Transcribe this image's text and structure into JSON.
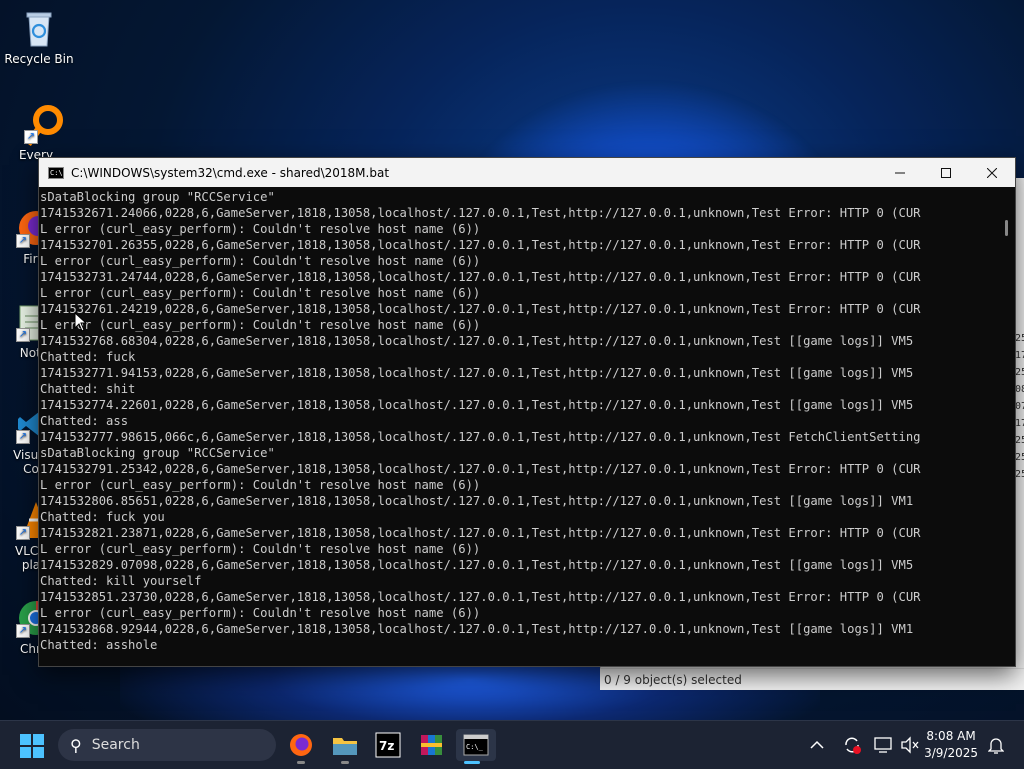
{
  "desktop": {
    "icons": [
      {
        "label": "Recycle Bin"
      },
      {
        "label": "Every"
      },
      {
        "label": "Fire"
      },
      {
        "label": "Note"
      },
      {
        "label": "Visual Co"
      },
      {
        "label": "VLC r pla"
      },
      {
        "label": "Chro"
      }
    ]
  },
  "console": {
    "title": "C:\\WINDOWS\\system32\\cmd.exe - shared\\2018M.bat",
    "lines": [
      "sDataBlocking group \"RCCService\"",
      "1741532671.24066,0228,6,GameServer,1818,13058,localhost/.127.0.0.1,Test,http://127.0.0.1,unknown,Test Error: HTTP 0 (CUR",
      "L error (curl_easy_perform): Couldn't resolve host name (6))",
      "1741532701.26355,0228,6,GameServer,1818,13058,localhost/.127.0.0.1,Test,http://127.0.0.1,unknown,Test Error: HTTP 0 (CUR",
      "L error (curl_easy_perform): Couldn't resolve host name (6))",
      "1741532731.24744,0228,6,GameServer,1818,13058,localhost/.127.0.0.1,Test,http://127.0.0.1,unknown,Test Error: HTTP 0 (CUR",
      "L error (curl_easy_perform): Couldn't resolve host name (6))",
      "1741532761.24219,0228,6,GameServer,1818,13058,localhost/.127.0.0.1,Test,http://127.0.0.1,unknown,Test Error: HTTP 0 (CUR",
      "L error (curl_easy_perform): Couldn't resolve host name (6))",
      "1741532768.68304,0228,6,GameServer,1818,13058,localhost/.127.0.0.1,Test,http://127.0.0.1,unknown,Test [[game logs]] VM5",
      "Chatted: fuck",
      "1741532771.94153,0228,6,GameServer,1818,13058,localhost/.127.0.0.1,Test,http://127.0.0.1,unknown,Test [[game logs]] VM5",
      "Chatted: shit",
      "1741532774.22601,0228,6,GameServer,1818,13058,localhost/.127.0.0.1,Test,http://127.0.0.1,unknown,Test [[game logs]] VM5",
      "Chatted: ass",
      "1741532777.98615,066c,6,GameServer,1818,13058,localhost/.127.0.0.1,Test,http://127.0.0.1,unknown,Test FetchClientSetting",
      "sDataBlocking group \"RCCService\"",
      "1741532791.25342,0228,6,GameServer,1818,13058,localhost/.127.0.0.1,Test,http://127.0.0.1,unknown,Test Error: HTTP 0 (CUR",
      "L error (curl_easy_perform): Couldn't resolve host name (6))",
      "1741532806.85651,0228,6,GameServer,1818,13058,localhost/.127.0.0.1,Test,http://127.0.0.1,unknown,Test [[game logs]] VM1",
      "Chatted: fuck you",
      "1741532821.23871,0228,6,GameServer,1818,13058,localhost/.127.0.0.1,Test,http://127.0.0.1,unknown,Test Error: HTTP 0 (CUR",
      "L error (curl_easy_perform): Couldn't resolve host name (6))",
      "1741532829.07098,0228,6,GameServer,1818,13058,localhost/.127.0.0.1,Test,http://127.0.0.1,unknown,Test [[game logs]] VM5",
      "Chatted: kill yourself",
      "1741532851.23730,0228,6,GameServer,1818,13058,localhost/.127.0.0.1,Test,http://127.0.0.1,unknown,Test Error: HTTP 0 (CUR",
      "L error (curl_easy_perform): Couldn't resolve host name (6))",
      "1741532868.92944,0228,6,GameServer,1818,13058,localhost/.127.0.0.1,Test,http://127.0.0.1,unknown,Test [[game logs]] VM1",
      "Chatted: asshole"
    ]
  },
  "explorer": {
    "status": "0 / 9 object(s) selected",
    "edge_digits": [
      "25",
      "17",
      "25",
      "08",
      "07",
      "17",
      "25",
      "25",
      "25"
    ]
  },
  "taskbar": {
    "search_label": "Search",
    "time": "8:08 AM",
    "date": "3/9/2025",
    "apps": [
      "firefox-icon",
      "file-explorer-icon",
      "7zip-icon",
      "winrar-icon",
      "terminal-icon"
    ]
  },
  "colors": {
    "console_bg": "#0c0c0c",
    "console_text": "#cccccc",
    "accent": "#4cc2ff"
  }
}
